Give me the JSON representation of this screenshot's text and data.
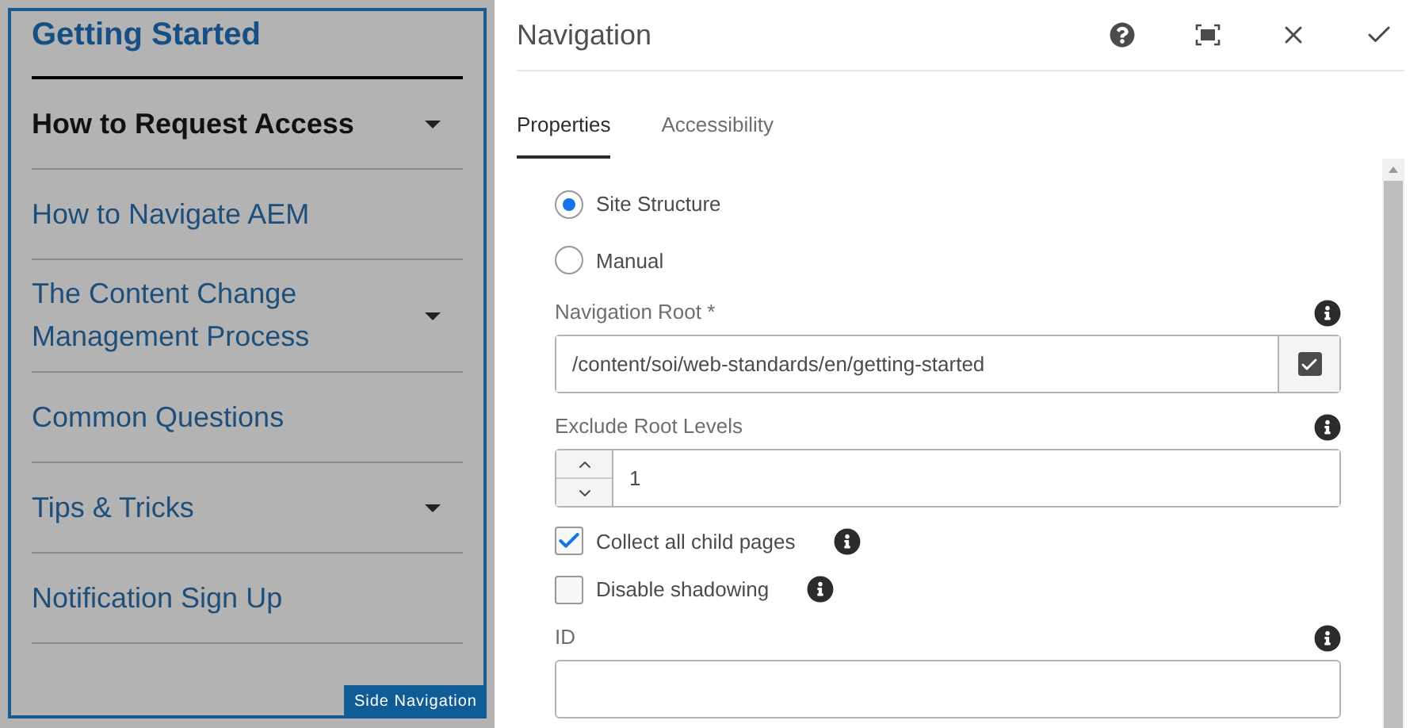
{
  "sidebar": {
    "title": "Getting Started",
    "items": [
      {
        "label": "How to Request Access",
        "selected": true,
        "expandable": true
      },
      {
        "label": "How to Navigate AEM",
        "selected": false,
        "expandable": false
      },
      {
        "label": "The Content Change Management Process",
        "selected": false,
        "expandable": true
      },
      {
        "label": "Common Questions",
        "selected": false,
        "expandable": false
      },
      {
        "label": "Tips & Tricks",
        "selected": false,
        "expandable": true
      },
      {
        "label": "Notification Sign Up",
        "selected": false,
        "expandable": false
      }
    ],
    "badge": "Side Navigation"
  },
  "dialog": {
    "title": "Navigation",
    "tabs": [
      {
        "label": "Properties",
        "selected": true
      },
      {
        "label": "Accessibility",
        "selected": false
      }
    ],
    "fields": [
      {
        "kind": "radio",
        "label": "Site Structure",
        "selected": true
      },
      {
        "kind": "radio",
        "label": "Manual",
        "selected": false
      },
      {
        "kind": "path",
        "label": "Navigation Root *",
        "value": "/content/soi/web-standards/en/getting-started"
      },
      {
        "kind": "number",
        "label": "Exclude Root Levels",
        "value": "1"
      },
      {
        "kind": "checkbox",
        "label": "Collect all child pages",
        "checked": true
      },
      {
        "kind": "checkbox",
        "label": "Disable shadowing",
        "checked": false
      },
      {
        "kind": "text",
        "label": "ID"
      }
    ]
  }
}
